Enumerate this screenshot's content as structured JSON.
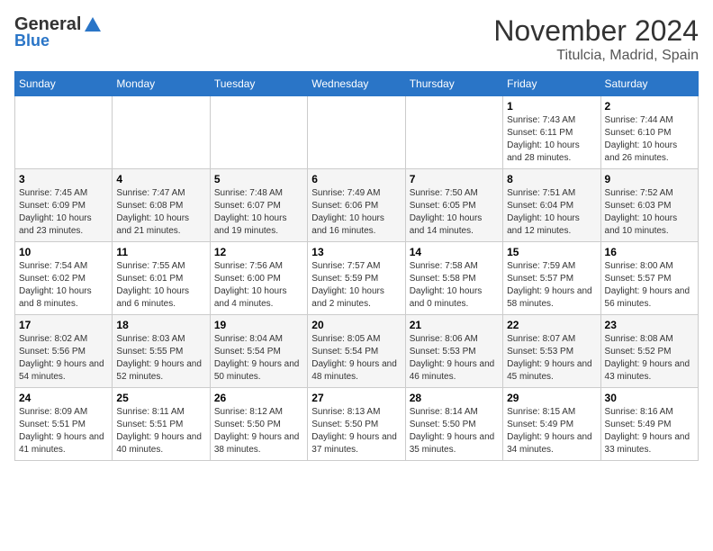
{
  "logo": {
    "general": "General",
    "blue": "Blue"
  },
  "title": "November 2024",
  "subtitle": "Titulcia, Madrid, Spain",
  "weekdays": [
    "Sunday",
    "Monday",
    "Tuesday",
    "Wednesday",
    "Thursday",
    "Friday",
    "Saturday"
  ],
  "weeks": [
    [
      {
        "day": "",
        "info": ""
      },
      {
        "day": "",
        "info": ""
      },
      {
        "day": "",
        "info": ""
      },
      {
        "day": "",
        "info": ""
      },
      {
        "day": "",
        "info": ""
      },
      {
        "day": "1",
        "info": "Sunrise: 7:43 AM\nSunset: 6:11 PM\nDaylight: 10 hours and 28 minutes."
      },
      {
        "day": "2",
        "info": "Sunrise: 7:44 AM\nSunset: 6:10 PM\nDaylight: 10 hours and 26 minutes."
      }
    ],
    [
      {
        "day": "3",
        "info": "Sunrise: 7:45 AM\nSunset: 6:09 PM\nDaylight: 10 hours and 23 minutes."
      },
      {
        "day": "4",
        "info": "Sunrise: 7:47 AM\nSunset: 6:08 PM\nDaylight: 10 hours and 21 minutes."
      },
      {
        "day": "5",
        "info": "Sunrise: 7:48 AM\nSunset: 6:07 PM\nDaylight: 10 hours and 19 minutes."
      },
      {
        "day": "6",
        "info": "Sunrise: 7:49 AM\nSunset: 6:06 PM\nDaylight: 10 hours and 16 minutes."
      },
      {
        "day": "7",
        "info": "Sunrise: 7:50 AM\nSunset: 6:05 PM\nDaylight: 10 hours and 14 minutes."
      },
      {
        "day": "8",
        "info": "Sunrise: 7:51 AM\nSunset: 6:04 PM\nDaylight: 10 hours and 12 minutes."
      },
      {
        "day": "9",
        "info": "Sunrise: 7:52 AM\nSunset: 6:03 PM\nDaylight: 10 hours and 10 minutes."
      }
    ],
    [
      {
        "day": "10",
        "info": "Sunrise: 7:54 AM\nSunset: 6:02 PM\nDaylight: 10 hours and 8 minutes."
      },
      {
        "day": "11",
        "info": "Sunrise: 7:55 AM\nSunset: 6:01 PM\nDaylight: 10 hours and 6 minutes."
      },
      {
        "day": "12",
        "info": "Sunrise: 7:56 AM\nSunset: 6:00 PM\nDaylight: 10 hours and 4 minutes."
      },
      {
        "day": "13",
        "info": "Sunrise: 7:57 AM\nSunset: 5:59 PM\nDaylight: 10 hours and 2 minutes."
      },
      {
        "day": "14",
        "info": "Sunrise: 7:58 AM\nSunset: 5:58 PM\nDaylight: 10 hours and 0 minutes."
      },
      {
        "day": "15",
        "info": "Sunrise: 7:59 AM\nSunset: 5:57 PM\nDaylight: 9 hours and 58 minutes."
      },
      {
        "day": "16",
        "info": "Sunrise: 8:00 AM\nSunset: 5:57 PM\nDaylight: 9 hours and 56 minutes."
      }
    ],
    [
      {
        "day": "17",
        "info": "Sunrise: 8:02 AM\nSunset: 5:56 PM\nDaylight: 9 hours and 54 minutes."
      },
      {
        "day": "18",
        "info": "Sunrise: 8:03 AM\nSunset: 5:55 PM\nDaylight: 9 hours and 52 minutes."
      },
      {
        "day": "19",
        "info": "Sunrise: 8:04 AM\nSunset: 5:54 PM\nDaylight: 9 hours and 50 minutes."
      },
      {
        "day": "20",
        "info": "Sunrise: 8:05 AM\nSunset: 5:54 PM\nDaylight: 9 hours and 48 minutes."
      },
      {
        "day": "21",
        "info": "Sunrise: 8:06 AM\nSunset: 5:53 PM\nDaylight: 9 hours and 46 minutes."
      },
      {
        "day": "22",
        "info": "Sunrise: 8:07 AM\nSunset: 5:53 PM\nDaylight: 9 hours and 45 minutes."
      },
      {
        "day": "23",
        "info": "Sunrise: 8:08 AM\nSunset: 5:52 PM\nDaylight: 9 hours and 43 minutes."
      }
    ],
    [
      {
        "day": "24",
        "info": "Sunrise: 8:09 AM\nSunset: 5:51 PM\nDaylight: 9 hours and 41 minutes."
      },
      {
        "day": "25",
        "info": "Sunrise: 8:11 AM\nSunset: 5:51 PM\nDaylight: 9 hours and 40 minutes."
      },
      {
        "day": "26",
        "info": "Sunrise: 8:12 AM\nSunset: 5:50 PM\nDaylight: 9 hours and 38 minutes."
      },
      {
        "day": "27",
        "info": "Sunrise: 8:13 AM\nSunset: 5:50 PM\nDaylight: 9 hours and 37 minutes."
      },
      {
        "day": "28",
        "info": "Sunrise: 8:14 AM\nSunset: 5:50 PM\nDaylight: 9 hours and 35 minutes."
      },
      {
        "day": "29",
        "info": "Sunrise: 8:15 AM\nSunset: 5:49 PM\nDaylight: 9 hours and 34 minutes."
      },
      {
        "day": "30",
        "info": "Sunrise: 8:16 AM\nSunset: 5:49 PM\nDaylight: 9 hours and 33 minutes."
      }
    ]
  ]
}
